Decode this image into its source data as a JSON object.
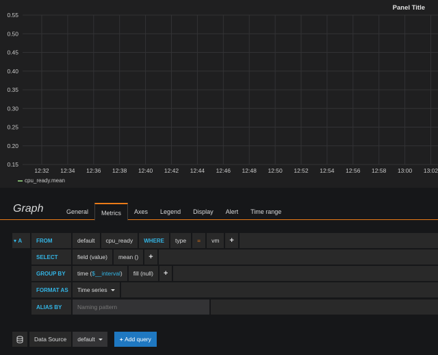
{
  "panel": {
    "title": "Panel Title",
    "legend": "cpu_ready.mean",
    "series_color": "#7eb26d",
    "y_ticks": [
      "0.55",
      "0.50",
      "0.45",
      "0.40",
      "0.35",
      "0.30",
      "0.25",
      "0.20",
      "0.15"
    ],
    "x_ticks": [
      "12:32",
      "12:34",
      "12:36",
      "12:38",
      "12:40",
      "12:42",
      "12:44",
      "12:46",
      "12:48",
      "12:50",
      "12:52",
      "12:54",
      "12:56",
      "12:58",
      "13:00",
      "13:02"
    ]
  },
  "editor": {
    "title": "Graph",
    "tabs": [
      {
        "label": "General"
      },
      {
        "label": "Metrics"
      },
      {
        "label": "Axes"
      },
      {
        "label": "Legend"
      },
      {
        "label": "Display"
      },
      {
        "label": "Alert"
      },
      {
        "label": "Time range"
      }
    ],
    "active_tab": "Metrics"
  },
  "query": {
    "ref_id": "A",
    "from": {
      "label": "FROM",
      "policy": "default",
      "measurement": "cpu_ready",
      "where_label": "WHERE",
      "tag_key": "type",
      "operator": "=",
      "tag_value": "vm"
    },
    "select": {
      "label": "SELECT",
      "field": "field (value)",
      "func": "mean ()"
    },
    "group_by": {
      "label": "GROUP BY",
      "time_prefix": "time (",
      "time_interval": "$__interval",
      "time_suffix": ")",
      "fill": "fill (null)"
    },
    "format_as": {
      "label": "FORMAT AS",
      "value": "Time series"
    },
    "alias_by": {
      "label": "ALIAS BY",
      "placeholder": "Naming pattern"
    },
    "plus": "+"
  },
  "footer": {
    "data_source_label": "Data Source",
    "data_source_value": "default",
    "add_query_label": "Add query",
    "add_query_plus": "+"
  },
  "colors": {
    "accent": "#eb7b18",
    "keyword": "#33b5e5",
    "primary_button": "#1f78c1"
  }
}
